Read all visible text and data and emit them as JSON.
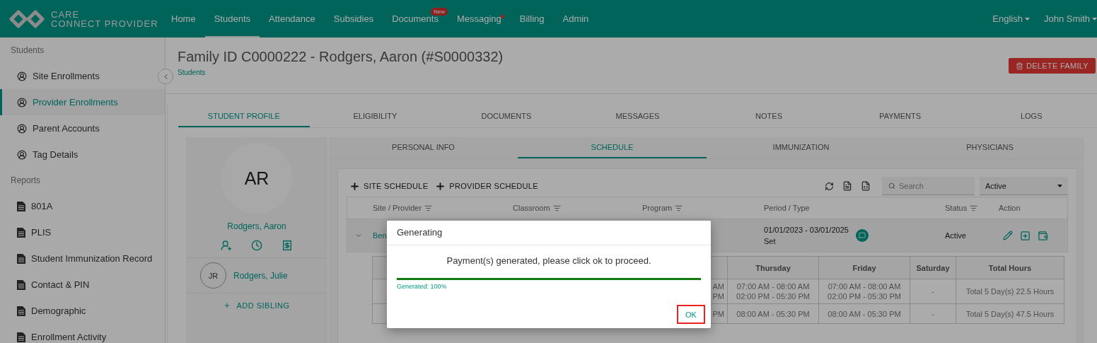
{
  "header": {
    "logo_line_1": "CARE",
    "logo_line_2": "CONNECT PROVIDER",
    "nav": [
      {
        "label": "Home",
        "selected": false,
        "dot": false
      },
      {
        "label": "Students",
        "selected": true,
        "dot": false
      },
      {
        "label": "Attendance",
        "selected": false,
        "dot": false
      },
      {
        "label": "Subsidies",
        "selected": false,
        "dot": false
      },
      {
        "label": "Documents",
        "selected": false,
        "dot": false,
        "badge": "New"
      },
      {
        "label": "Messaging",
        "selected": false,
        "dot": true
      },
      {
        "label": "Billing",
        "selected": false,
        "dot": false
      },
      {
        "label": "Admin",
        "selected": false,
        "dot": false
      }
    ],
    "language": "English",
    "user": "John Smith"
  },
  "sidebar": {
    "sections": [
      {
        "title": "Students",
        "kind": "person",
        "items": [
          {
            "label": "Site Enrollments",
            "selected": false
          },
          {
            "label": "Provider Enrollments",
            "selected": true
          },
          {
            "label": "Parent Accounts",
            "selected": false
          },
          {
            "label": "Tag Details",
            "selected": false
          }
        ]
      },
      {
        "title": "Reports",
        "kind": "report",
        "items": [
          {
            "label": "801A",
            "selected": false
          },
          {
            "label": "PLIS",
            "selected": false
          },
          {
            "label": "Student Immunization Record",
            "selected": false
          },
          {
            "label": "Contact & PIN",
            "selected": false
          },
          {
            "label": "Demographic",
            "selected": false
          },
          {
            "label": "Enrollment Activity",
            "selected": false
          }
        ]
      }
    ]
  },
  "page": {
    "title": "Family ID C0000222 - Rodgers, Aaron (#S0000332)",
    "breadcrumb": "Students",
    "delete_button": "DELETE FAMILY"
  },
  "tabs": [
    {
      "label": "STUDENT PROFILE",
      "selected": true
    },
    {
      "label": "ELIGIBILITY",
      "selected": false
    },
    {
      "label": "DOCUMENTS",
      "selected": false
    },
    {
      "label": "MESSAGES",
      "selected": false
    },
    {
      "label": "NOTES",
      "selected": false
    },
    {
      "label": "PAYMENTS",
      "selected": false
    },
    {
      "label": "LOGS",
      "selected": false
    }
  ],
  "profile": {
    "initials": "AR",
    "name": "Rodgers, Aaron",
    "siblings": [
      {
        "initials": "JR",
        "name": "Rodgers, Julie"
      }
    ],
    "add_sibling": "ADD SIBLING"
  },
  "subtabs": [
    {
      "label": "PERSONAL INFO",
      "selected": false
    },
    {
      "label": "SCHEDULE",
      "selected": true
    },
    {
      "label": "IMMUNIZATION",
      "selected": false
    },
    {
      "label": "PHYSICIANS",
      "selected": false
    }
  ],
  "schedule": {
    "actions": [
      "SITE SCHEDULE",
      "PROVIDER SCHEDULE"
    ],
    "search": {
      "placeholder": "Search"
    },
    "status_filter": "Active",
    "columns": [
      {
        "label": "Site / Provider",
        "filter": true
      },
      {
        "label": "Classroom",
        "filter": true
      },
      {
        "label": "Program",
        "filter": true
      },
      {
        "label": "Period / Type",
        "filter": false
      },
      {
        "label": "Status",
        "filter": true
      },
      {
        "label": "Action",
        "filter": false
      }
    ],
    "rows": [
      {
        "site": "Ben",
        "period": "01/01/2023 - 03/01/2025",
        "type": "Set",
        "status": "Active",
        "expanded": true
      }
    ],
    "detail": {
      "columns": [
        "",
        "Thursday",
        "Friday",
        "Saturday",
        "Total Hours"
      ],
      "rows": [
        [
          [
            "AM",
            "PM"
          ],
          [
            "07:00 AM - 08:00 AM",
            "02:00 PM - 05:30 PM"
          ],
          [
            "07:00 AM - 08:00 AM",
            "02:00 PM - 05:30 PM"
          ],
          [
            "-"
          ],
          [
            "Total 5 Day(s) 22.5 Hours"
          ]
        ],
        [
          [
            "PM"
          ],
          [
            "08:00 AM - 05:30 PM"
          ],
          [
            "08:00 AM - 05:30 PM"
          ],
          [
            "-"
          ],
          [
            "Total 5 Day(s) 47.5 Hours"
          ]
        ]
      ]
    }
  },
  "dialog": {
    "title": "Generating",
    "message": "Payment(s) generated, please click ok to proceed.",
    "level": 1,
    "progress_label": "Generated: 100%",
    "ok": "OK",
    "ok_highlighted": true
  }
}
